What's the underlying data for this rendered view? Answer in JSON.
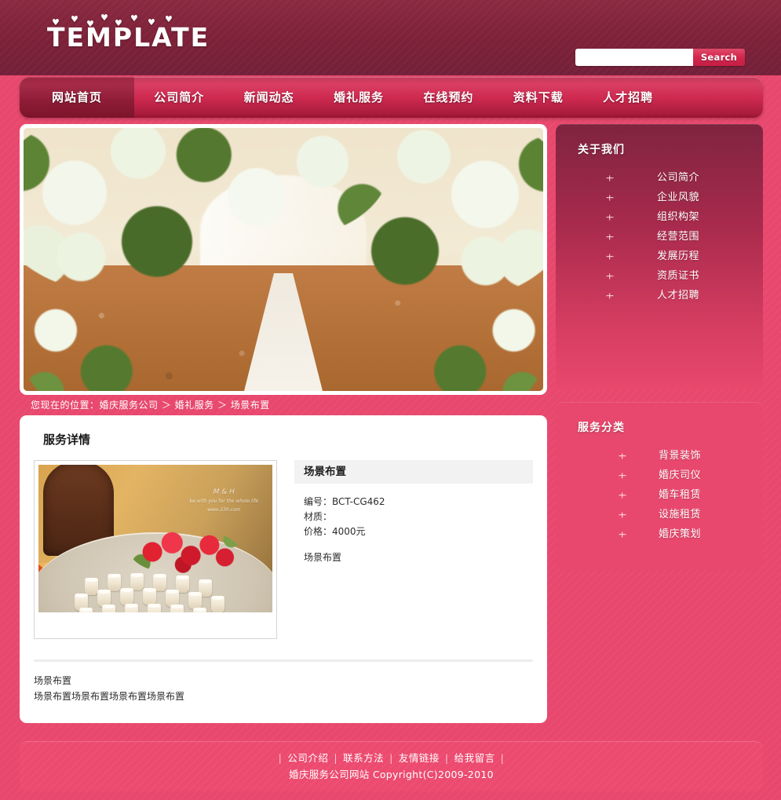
{
  "site": {
    "logo_text": "TEMPLATE",
    "title": "婚庆服务公司网站"
  },
  "search": {
    "value": "",
    "placeholder": "",
    "button_label": "Search",
    "icon": "search-icon"
  },
  "nav": {
    "items": [
      {
        "label": "网站首页",
        "active": true
      },
      {
        "label": "公司简介",
        "active": false
      },
      {
        "label": "新闻动态",
        "active": false
      },
      {
        "label": "婚礼服务",
        "active": false
      },
      {
        "label": "在线预约",
        "active": false
      },
      {
        "label": "资料下载",
        "active": false
      },
      {
        "label": "人才招聘",
        "active": false
      }
    ]
  },
  "hero": {
    "alt": "婚礼现场鲜花拱门与白色地毯通道"
  },
  "breadcrumb": {
    "text": "您现在的位置：婚庆服务公司 ＞ 婚礼服务 ＞ 场景布置",
    "prefix": "您现在的位置：",
    "items": [
      "婚庆服务公司",
      "婚礼服务",
      "场景布置"
    ],
    "separator": "＞"
  },
  "content": {
    "section_title": "服务详情",
    "product": {
      "name": "场景布置",
      "image_alt": "圆桌上摆放的纸杯与红色玫瑰花束",
      "watermark_line1": "M & H",
      "watermark_line2": "be with you for the whole life",
      "watermark_line3": "www.23h.com",
      "fields": [
        {
          "label": "编号：",
          "value": "BCT-CG462"
        },
        {
          "label": "材质：",
          "value": ""
        },
        {
          "label": "价格：",
          "value": "4000元"
        }
      ],
      "summary": "场景布置"
    },
    "description_lines": [
      "场景布置",
      "场景布置场景布置场景布置场景布置"
    ]
  },
  "sidebar": {
    "panels": [
      {
        "title": "关于我们",
        "items": [
          {
            "label": "公司简介"
          },
          {
            "label": "企业风貌"
          },
          {
            "label": "组织构架"
          },
          {
            "label": "经营范围"
          },
          {
            "label": "发展历程"
          },
          {
            "label": "资质证书"
          },
          {
            "label": "人才招聘"
          }
        ]
      },
      {
        "title": "服务分类",
        "items": [
          {
            "label": "背景装饰"
          },
          {
            "label": "婚庆司仪"
          },
          {
            "label": "婚车租赁"
          },
          {
            "label": "设施租赁"
          },
          {
            "label": "婚庆策划"
          }
        ]
      }
    ]
  },
  "footer": {
    "links": [
      "公司介绍",
      "联系方法",
      "友情链接",
      "给我留言"
    ],
    "separator": "|",
    "copyright": "婚庆服务公司网站 Copyright(C)2009-2010"
  },
  "colors": {
    "header_bg": "#7d2239",
    "page_bg": "#e8486d",
    "nav_gradient_top": "#d93e62",
    "nav_active": "#9e2741",
    "search_button": "#d3254c",
    "panel_about_top": "#7f2440",
    "panel_service": "#e8486d",
    "footer_bg": "#ec4a6f",
    "content_bg": "#ffffff",
    "detail_head_bg": "#f2f2f2"
  }
}
